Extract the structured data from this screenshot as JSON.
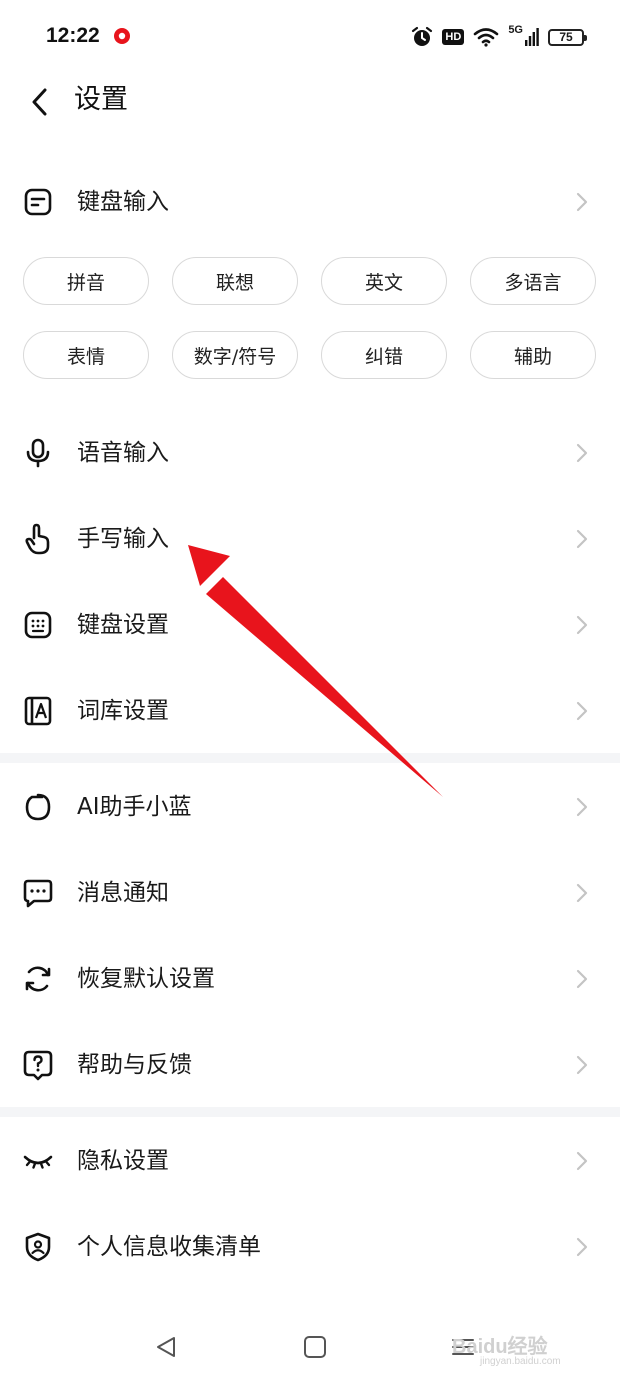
{
  "status_bar": {
    "time": "12:22",
    "hd": "HD",
    "network": "5G",
    "battery": "75"
  },
  "header": {
    "title": "设置"
  },
  "sections": {
    "keyboard_input": "键盘输入",
    "chips_row1": [
      "拼音",
      "联想",
      "英文",
      "多语言"
    ],
    "chips_row2": [
      "表情",
      "数字/符号",
      "纠错",
      "辅助"
    ],
    "voice_input": "语音输入",
    "handwriting_input": "手写输入",
    "keyboard_settings": "键盘设置",
    "lexicon_settings": "词库设置",
    "ai_assistant": "AI助手小蓝",
    "notifications": "消息通知",
    "restore_defaults": "恢复默认设置",
    "help_feedback": "帮助与反馈",
    "privacy_settings": "隐私设置",
    "personal_info_list": "个人信息收集清单"
  },
  "watermark": {
    "brand": "Baidu经验",
    "url": "jingyan.baidu.com"
  },
  "colors": {
    "annotation_arrow": "#e8141c",
    "divider": "#f4f5f7",
    "chip_border": "#d9d9d9",
    "chevron": "#c4c4c4"
  }
}
